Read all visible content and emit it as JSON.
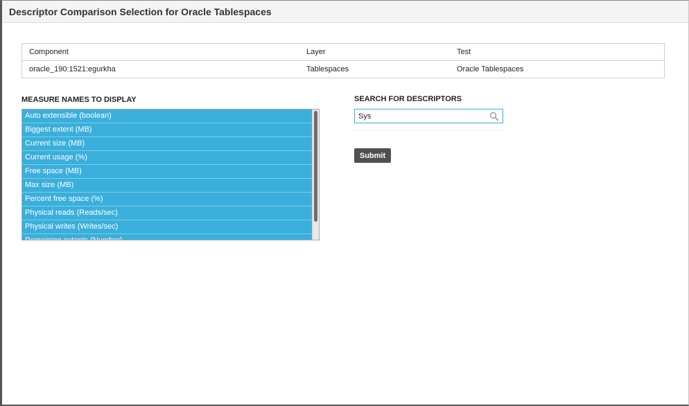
{
  "window": {
    "title": "Descriptor Comparison Selection for Oracle Tablespaces"
  },
  "info_table": {
    "headers": [
      "Component",
      "Layer",
      "Test"
    ],
    "row": [
      "oracle_190:1521:egurkha",
      "Tablespaces",
      "Oracle Tablespaces"
    ]
  },
  "measures": {
    "label": "MEASURE NAMES TO DISPLAY",
    "items": [
      "Auto extensible (boolean)",
      "Biggest extent (MB)",
      "Current size (MB)",
      "Current usage (%)",
      "Free space (MB)",
      "Max size (MB)",
      "Percent free space (%)",
      "Physical reads (Reads/sec)",
      "Physical writes (Writes/sec)",
      "Remaining extents (Number)"
    ],
    "selected_color": "#3aafdb"
  },
  "search": {
    "label": "SEARCH FOR DESCRIPTORS",
    "value": "Sys",
    "icon": "search-icon"
  },
  "actions": {
    "submit_label": "Submit"
  }
}
